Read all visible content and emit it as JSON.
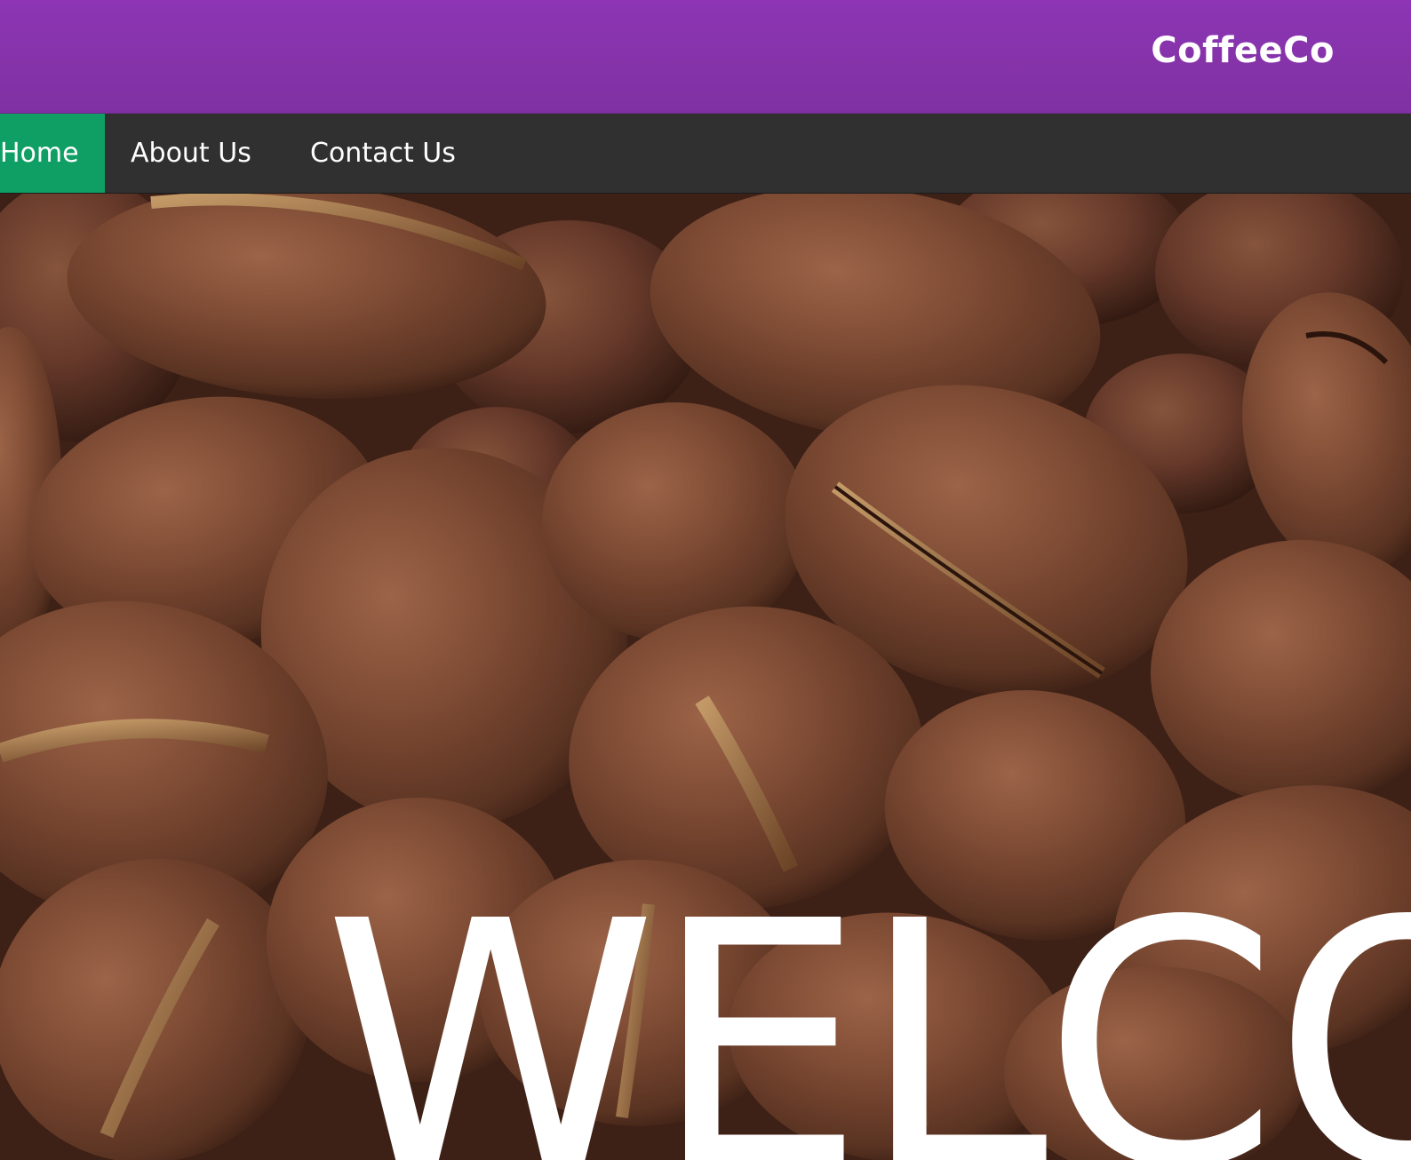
{
  "header": {
    "brand": "CoffeeCo",
    "background_color": "#8a35b0"
  },
  "nav": {
    "background_color": "#303030",
    "active_color": "#0f9e63",
    "items": [
      {
        "label": "Home",
        "active": true
      },
      {
        "label": "About Us",
        "active": false
      },
      {
        "label": "Contact Us",
        "active": false
      }
    ]
  },
  "hero": {
    "image": "coffee-beans-photo",
    "title": "WELCO"
  }
}
